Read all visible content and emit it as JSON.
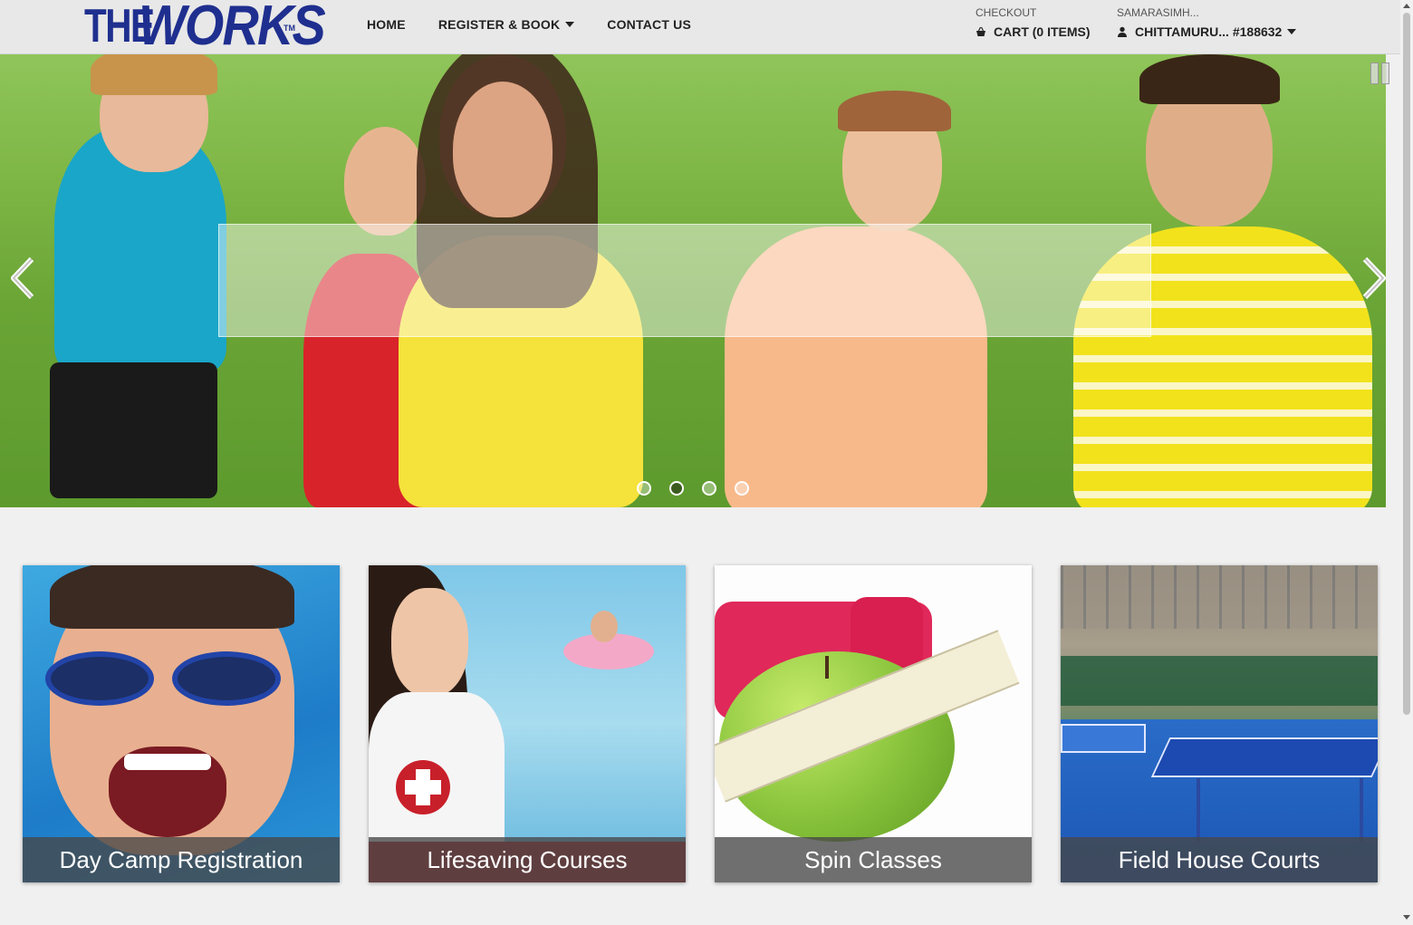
{
  "header": {
    "logo_the": "THE",
    "logo_works": "WORKS",
    "logo_tm": "TM",
    "nav": [
      {
        "label": "HOME"
      },
      {
        "label": "REGISTER & BOOK"
      },
      {
        "label": "CONTACT US"
      }
    ],
    "checkout_label": "CHECKOUT",
    "cart_label": "CART (0 ITEMS)",
    "user_small": "SAMARASIMH...",
    "user_main": "CHITTAMURU... #188632"
  },
  "hero": {
    "slide_count": 4,
    "active_slide": 2
  },
  "cards": [
    {
      "label": "Day Camp Registration"
    },
    {
      "label": "Lifesaving Courses"
    },
    {
      "label": "Spin Classes"
    },
    {
      "label": "Field House Courts"
    }
  ],
  "colors": {
    "brand": "#1f2f8f",
    "active_dot": "#3b5b1e"
  }
}
